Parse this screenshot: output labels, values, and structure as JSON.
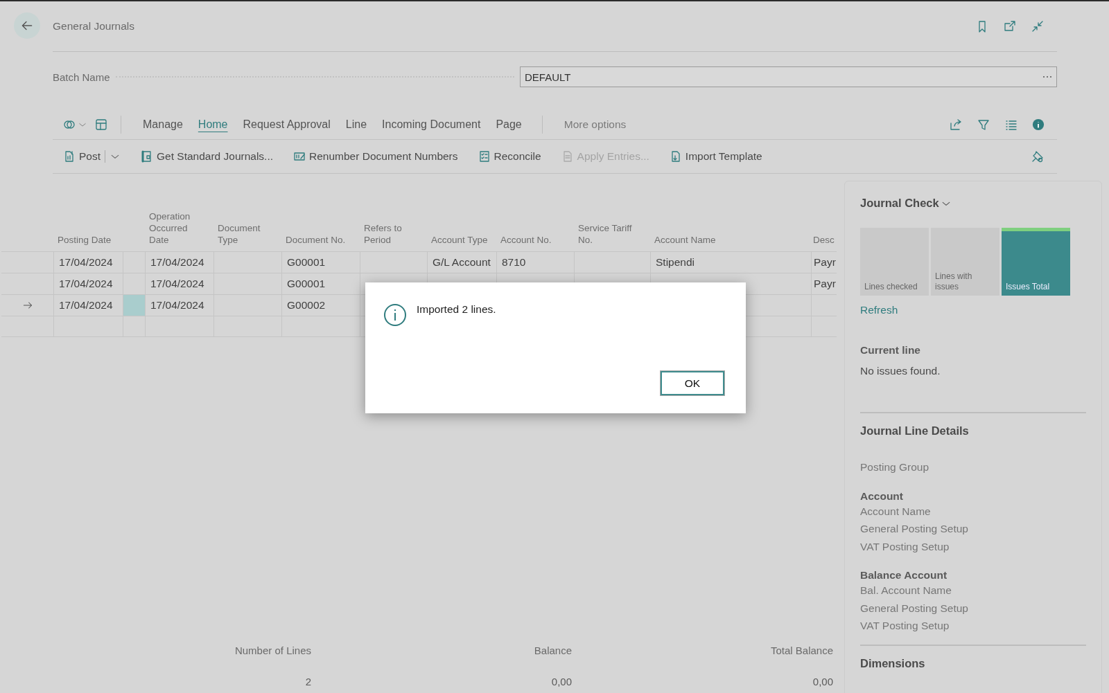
{
  "page": {
    "title": "General Journals"
  },
  "batch": {
    "label": "Batch Name",
    "value": "DEFAULT"
  },
  "action_tabs": [
    {
      "label": "Manage",
      "selected": false
    },
    {
      "label": "Home",
      "selected": true
    },
    {
      "label": "Request Approval",
      "selected": false
    },
    {
      "label": "Line",
      "selected": false
    },
    {
      "label": "Incoming Document",
      "selected": false
    },
    {
      "label": "Page",
      "selected": false
    }
  ],
  "more_options": "More options",
  "actions": [
    {
      "label": "Post",
      "disabled": false,
      "kind": "split"
    },
    {
      "label": "Get Standard Journals...",
      "disabled": false,
      "kind": "plain"
    },
    {
      "label": "Renumber Document Numbers",
      "disabled": false,
      "kind": "plain"
    },
    {
      "label": "Reconcile",
      "disabled": false,
      "kind": "plain"
    },
    {
      "label": "Apply Entries...",
      "disabled": true,
      "kind": "plain"
    },
    {
      "label": "Import Template",
      "disabled": false,
      "kind": "plain"
    }
  ],
  "table": {
    "columns": [
      "Posting Date",
      "Operation Occurred Date",
      "Document Type",
      "Document No.",
      "Refers to Period",
      "Account Type",
      "Account No.",
      "Service Tariff No.",
      "Account Name",
      "Desc"
    ],
    "rows": [
      {
        "current": false,
        "cells": [
          "17/04/2024",
          "17/04/2024",
          null,
          "G00001",
          null,
          "G/L Account",
          "8710",
          null,
          "Stipendi",
          "Payr"
        ]
      },
      {
        "current": false,
        "cells": [
          "17/04/2024",
          "17/04/2024",
          null,
          "G00001",
          null,
          null,
          null,
          null,
          null,
          "Payr"
        ]
      },
      {
        "current": true,
        "cells": [
          "17/04/2024",
          "17/04/2024",
          null,
          "G00002",
          null,
          null,
          null,
          null,
          null,
          null
        ]
      }
    ]
  },
  "totals": [
    {
      "label": "Number of Lines",
      "value": "2"
    },
    {
      "label": "Balance",
      "value": "0,00"
    },
    {
      "label": "Total Balance",
      "value": "0,00"
    }
  ],
  "side_panel": {
    "title": "Journal Check",
    "tiles": [
      {
        "label": "Lines checked",
        "color": "#c9c9c9",
        "kind": "plain"
      },
      {
        "label": "Lines with issues",
        "color": "#c9c9c9",
        "kind": "plain"
      },
      {
        "label": "Issues Total",
        "color": "#3c8a8c",
        "kind": "highlight"
      }
    ],
    "refresh": "Refresh",
    "current_line": {
      "heading": "Current line",
      "text": "No issues found."
    },
    "details": {
      "title": "Journal Line Details",
      "sections": [
        {
          "items": [
            "Posting Group"
          ]
        },
        {
          "heading": "Account",
          "items": [
            "Account Name",
            "General Posting Setup",
            "VAT Posting Setup"
          ]
        },
        {
          "heading": "Balance Account",
          "items": [
            "Bal. Account Name",
            "General Posting Setup",
            "VAT Posting Setup"
          ]
        }
      ]
    },
    "dimensions": "Dimensions"
  },
  "dialog": {
    "message": "Imported 2 lines.",
    "button": "OK"
  }
}
